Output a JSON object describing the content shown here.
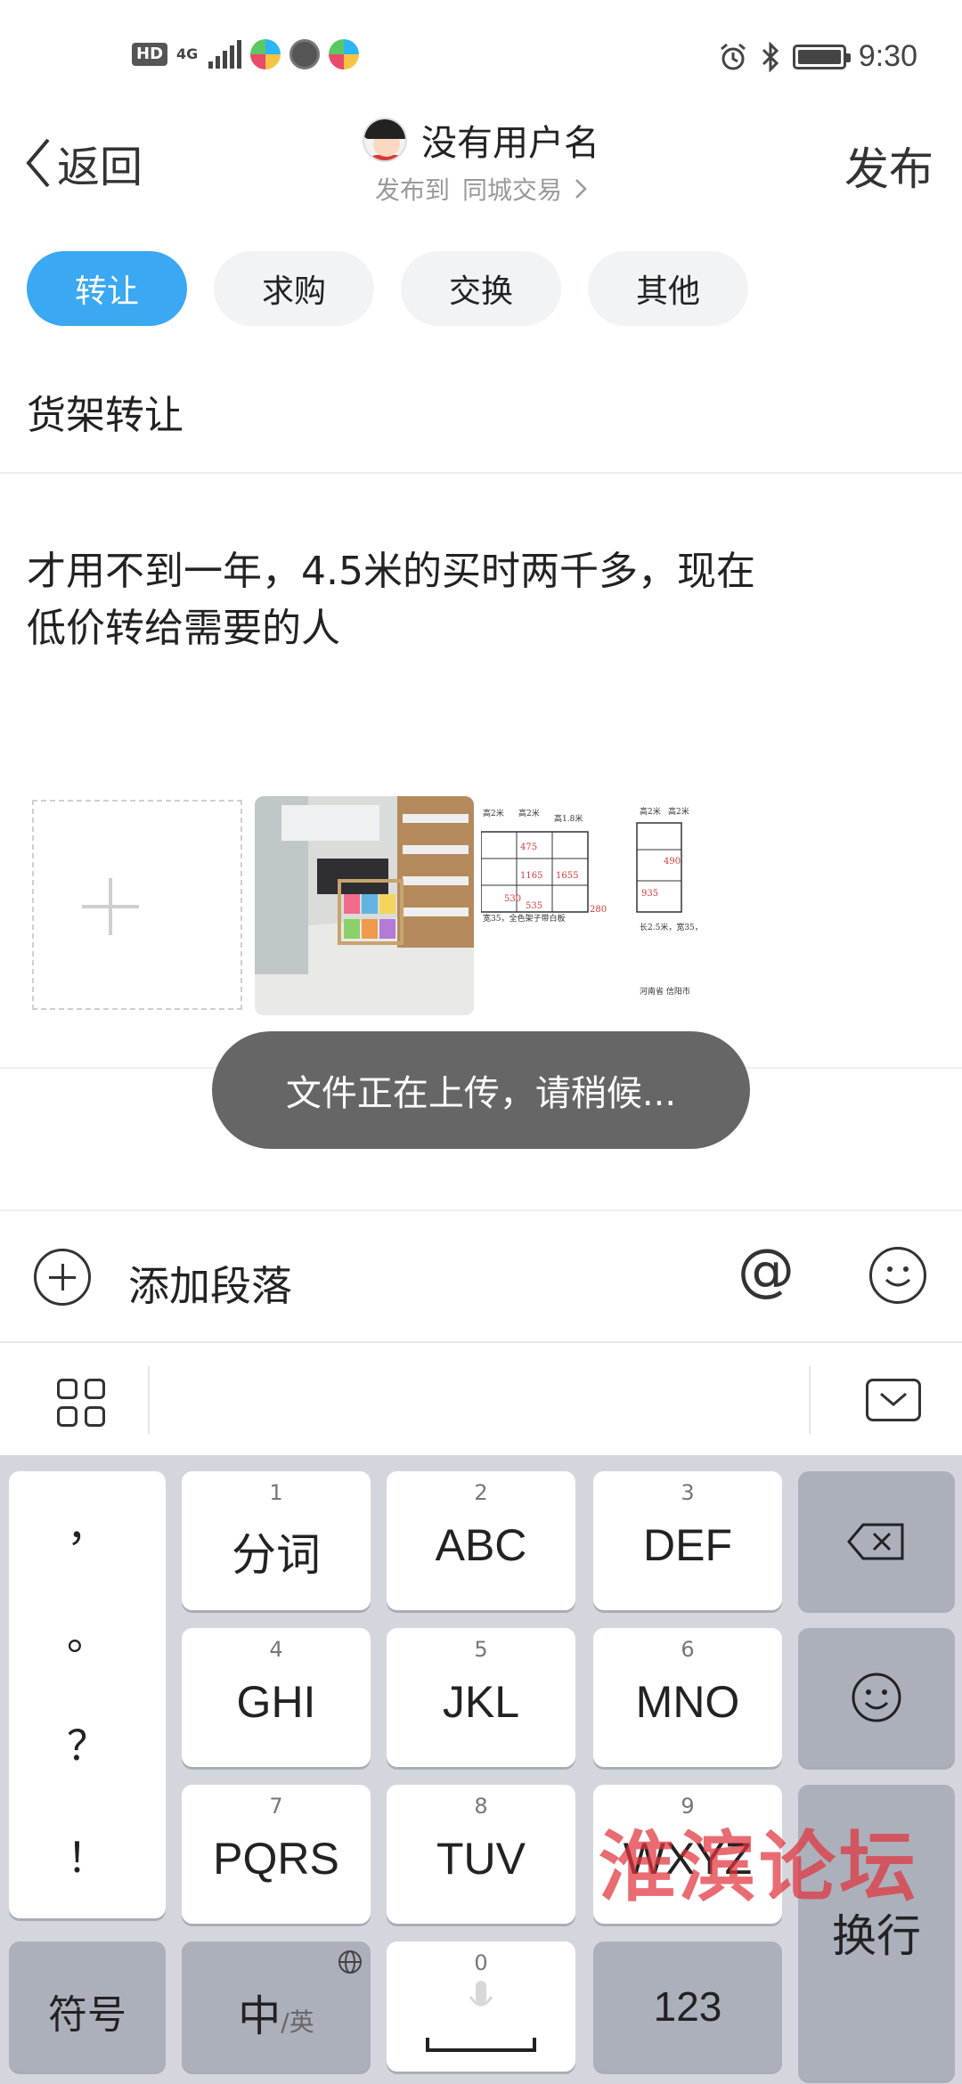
{
  "status_bar": {
    "hd": "HD",
    "network": "4G",
    "time": "9:30"
  },
  "header": {
    "back_label": "返回",
    "username": "没有用户名",
    "publish_to_label": "发布到",
    "target_forum": "同城交易",
    "publish_label": "发布"
  },
  "categories": [
    {
      "label": "转让",
      "active": true
    },
    {
      "label": "求购",
      "active": false
    },
    {
      "label": "交换",
      "active": false
    },
    {
      "label": "其他",
      "active": false
    }
  ],
  "post": {
    "title": "货架转让",
    "body_line1": "才用不到一年，4.5米的买时两千多，现在",
    "body_line2": "低价转给需要的人"
  },
  "thumbnail_2": {
    "labels": [
      "高2米",
      "高2米",
      "高1.8米",
      "1165",
      "1655",
      "475",
      "530",
      "535",
      "280",
      "宽35，全色架子带白板"
    ],
    "labels_b": [
      "高2米",
      "高2米",
      "490",
      "935",
      "长2.5米，宽35，",
      "河南省 信阳市"
    ]
  },
  "toast": "文件正在上传，请稍候...",
  "toolbar": {
    "add_paragraph": "添加段落",
    "at_symbol": "@"
  },
  "keyboard": {
    "punctuation": [
      "，",
      "。",
      "？",
      "！"
    ],
    "rows": [
      [
        {
          "num": "1",
          "label": "分词"
        },
        {
          "num": "2",
          "label": "ABC"
        },
        {
          "num": "3",
          "label": "DEF"
        }
      ],
      [
        {
          "num": "4",
          "label": "GHI"
        },
        {
          "num": "5",
          "label": "JKL"
        },
        {
          "num": "6",
          "label": "MNO"
        }
      ],
      [
        {
          "num": "7",
          "label": "PQRS"
        },
        {
          "num": "8",
          "label": "TUV"
        },
        {
          "num": "9",
          "label": "WXYZ"
        }
      ]
    ],
    "symbols_key": "符号",
    "lang_key_main": "中",
    "lang_key_sub": "/英",
    "space_num": "0",
    "num_key": "123",
    "enter_key": "换行"
  },
  "watermark": "淮滨论坛",
  "colors": {
    "accent": "#3aa8f2",
    "toast_bg": "#666666",
    "keyboard_bg": "#d3d6dd",
    "watermark": "#e0343c"
  }
}
